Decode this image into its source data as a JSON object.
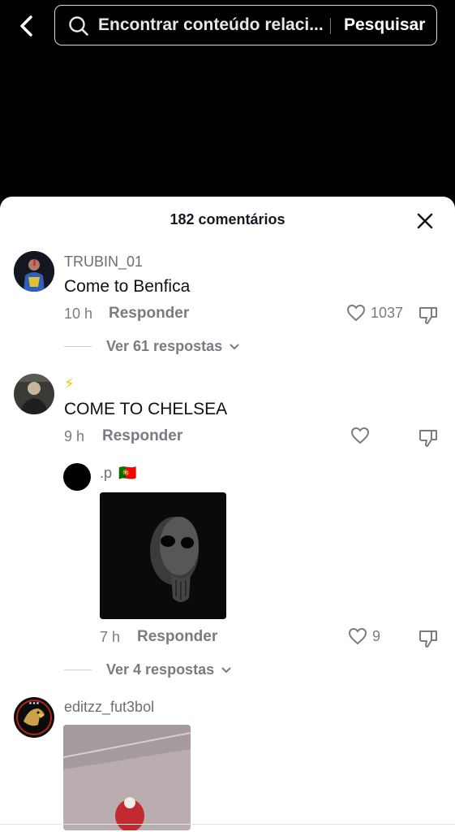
{
  "search": {
    "placeholder": "Encontrar conteúdo relaci...",
    "button_label": "Pesquisar"
  },
  "comments_sheet": {
    "title": "182 comentários"
  },
  "comments": [
    {
      "username": "TRUBIN_01",
      "text": "Come to Benfica",
      "time": "10 h",
      "reply_label": "Responder",
      "likes": "1037",
      "view_replies": "Ver 61 respostas"
    },
    {
      "username": "⚡",
      "text": "COME TO CHELSEA",
      "time": "9 h",
      "reply_label": "Responder",
      "likes": "",
      "reply": {
        "username": ".p",
        "flag": "🇵🇹",
        "time": "7 h",
        "reply_label": "Responder",
        "likes": "9"
      },
      "view_replies": "Ver 4 respostas"
    },
    {
      "username": "editzz_fut3bol"
    }
  ],
  "colors": {
    "background": "#000000",
    "sheet": "#ffffff",
    "muted_text": "#7a7b82"
  }
}
